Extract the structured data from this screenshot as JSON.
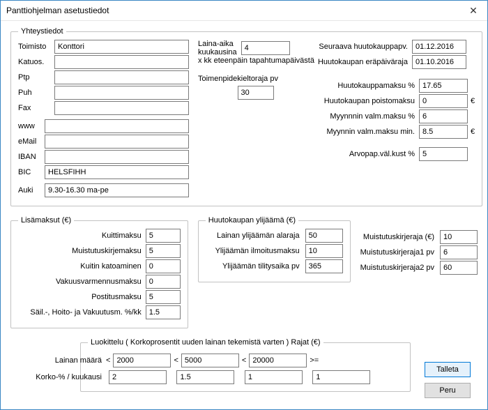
{
  "window": {
    "title": "Panttiohjelman asetustiedot",
    "close": "✕"
  },
  "contact": {
    "legend": "Yhteystiedot",
    "labels": {
      "toimisto": "Toimisto",
      "katuos": "Katuos.",
      "ptp": "Ptp",
      "puh": "Puh",
      "fax": "Fax",
      "www": "www",
      "email": "eMail",
      "iban": "IBAN",
      "bic": "BIC",
      "auki": "Auki"
    },
    "values": {
      "toimisto": "Konttori",
      "katuos": "",
      "ptp": "",
      "puh": "",
      "fax": "",
      "www": "",
      "email": "",
      "iban": "",
      "bic": "HELSFIHH",
      "auki": "9.30-16.30 ma-pe"
    }
  },
  "laina": {
    "label1": "Laina-aika",
    "label2": "kuukausina",
    "sub": "x kk eteenpäin tapahtumapäivästä",
    "value": "4"
  },
  "toimenpide": {
    "label": "Toimenpidekieltoraja pv",
    "value": "30"
  },
  "dates": {
    "next_label": "Seuraava huutokauppapv.",
    "next_value": "01.12.2016",
    "eraraj_label": "Huutokaupan eräpäiväraja",
    "eraraj_value": "01.10.2016"
  },
  "numbers": {
    "maksupct_label": "Huutokauppamaksu %",
    "maksupct_value": "17.65",
    "poisto_label": "Huutokaupan poistomaksu",
    "poisto_value": "0",
    "myynnin_label": "Myynnnin valm.maksu %",
    "myynnin_value": "6",
    "myynninmin_label": "Myynnin valm.maksu min.",
    "myynninmin_value": "8.5",
    "arvopap_label": "Arvopap.väl.kust %",
    "arvopap_value": "5"
  },
  "lisamaksut": {
    "legend": "Lisämaksut (€)",
    "kuitti_label": "Kuittimaksu",
    "kuitti_value": "5",
    "muistutus_label": "Muistutuskirjemaksu",
    "muistutus_value": "5",
    "katoam_label": "Kuitin katoaminen",
    "katoam_value": "0",
    "vakuus_label": "Vakuusvarmennusmaksu",
    "vakuus_value": "0",
    "postitus_label": "Postitusmaksu",
    "postitus_value": "5",
    "sail_label": "Säil.-, Hoito- ja Vakuutusm. %/kk",
    "sail_value": "1.5"
  },
  "ylijaama": {
    "legend": "Huutokaupan ylijäämä (€)",
    "alaraja_label": "Lainan ylijäämän alaraja",
    "alaraja_value": "50",
    "ilmoitus_label": "Ylijäämän ilmoitusmaksu",
    "ilmoitus_value": "10",
    "tilitys_label": "Ylijäämän tilitysaika pv",
    "tilitys_value": "365"
  },
  "muistut": {
    "e_label": "Muistutuskirjeraja (€)",
    "e_value": "10",
    "pv1_label": "Muistutuskirjeraja1 pv",
    "pv1_value": "6",
    "pv2_label": "Muistutuskirjeraja2 pv",
    "pv2_value": "60"
  },
  "luokittelu": {
    "legend": "Luokittelu ( Korkoprosentit uuden lainan tekemistä varten ) Rajat (€)",
    "lainan_label": "Lainan määrä",
    "lt": "<",
    "gte": ">=",
    "lainan_vals": [
      "2000",
      "5000",
      "20000"
    ],
    "korko_label": "Korko-% / kuukausi",
    "korko_vals": [
      "2",
      "1.5",
      "1",
      "1"
    ]
  },
  "buttons": {
    "save": "Talleta",
    "cancel": "Peru"
  },
  "eur": "€"
}
